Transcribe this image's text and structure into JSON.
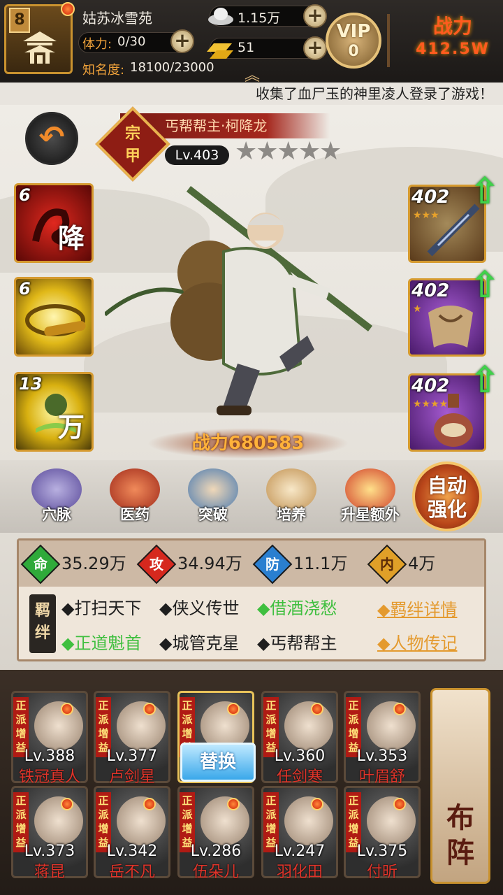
{
  "player": {
    "level": "8",
    "name": "姑苏冰雪苑",
    "stamina_label": "体力:",
    "stamina_value": "0/30",
    "fame_label": "知名度:",
    "fame_value": "18100/23000"
  },
  "currency": {
    "silver": "1.15万",
    "gold": "51"
  },
  "vip": {
    "label": "VIP",
    "level": "0"
  },
  "top_power": {
    "label": "战力",
    "value": "412.5W"
  },
  "marquee": "收集了血尸玉的神里凌人登录了游戏！",
  "hero": {
    "title": "丐帮帮主·柯降龙",
    "sect_badge": "宗\n甲",
    "level": "Lv.403",
    "stars": "★★★★★",
    "stars_count": 5,
    "power_label": "战力",
    "power_value": "680583"
  },
  "skills": [
    {
      "count": "6",
      "glyph": "降",
      "icon": "dragon-skill-icon"
    },
    {
      "count": "6",
      "glyph": "",
      "icon": "whirl-staff-skill-icon"
    },
    {
      "count": "13",
      "glyph": "万",
      "icon": "book-skill-icon"
    }
  ],
  "equipment": [
    {
      "level": "402",
      "stars": "★★★",
      "icon": "staff-weapon-icon"
    },
    {
      "level": "402",
      "stars": "★",
      "icon": "cloak-armor-icon"
    },
    {
      "level": "402",
      "stars": "★★★★",
      "icon": "gourd-accessory-icon"
    }
  ],
  "actions": [
    {
      "label": "穴脉",
      "icon": "meridian-icon"
    },
    {
      "label": "医药",
      "icon": "medicine-icon"
    },
    {
      "label": "突破",
      "icon": "breakthrough-icon"
    },
    {
      "label": "培养",
      "icon": "cultivate-icon"
    },
    {
      "label": "升星额外",
      "icon": "star-up-icon"
    }
  ],
  "auto_enhance": "自动\n强化",
  "stats": [
    {
      "glyph": "命",
      "value": "35.29万",
      "color": "#2faa3a"
    },
    {
      "glyph": "攻",
      "value": "34.94万",
      "color": "#d6281e"
    },
    {
      "glyph": "防",
      "value": "11.1万",
      "color": "#2a7fd0"
    },
    {
      "glyph": "内",
      "value": "4万",
      "color": "#e0a028"
    }
  ],
  "bond_tag": "羁\n绊",
  "bonds": [
    {
      "text": "◆打扫天下",
      "active": false
    },
    {
      "text": "◆侠义传世",
      "active": false
    },
    {
      "text": "◆借酒浇愁",
      "active": true
    },
    {
      "text": "◆正道魁首",
      "active": true
    },
    {
      "text": "◆城管克星",
      "active": false
    },
    {
      "text": "◆丐帮帮主",
      "active": false
    }
  ],
  "links": {
    "bond_detail": "◆羁绊详情",
    "biography": "◆人物传记"
  },
  "team_tag": "正派增益",
  "swap_label": "替换",
  "team": [
    {
      "level": "Lv.388",
      "name": "铁冠真人"
    },
    {
      "level": "Lv.377",
      "name": "卢剑星"
    },
    {
      "level": "",
      "name": ""
    },
    {
      "level": "Lv.360",
      "name": "任剑寒"
    },
    {
      "level": "Lv.353",
      "name": "叶眉舒"
    },
    {
      "level": "Lv.373",
      "name": "蒋昆"
    },
    {
      "level": "Lv.342",
      "name": "岳不凡"
    },
    {
      "level": "Lv.286",
      "name": "伍朵儿"
    },
    {
      "level": "Lv.247",
      "name": "羽化田"
    },
    {
      "level": "Lv.375",
      "name": "付昕"
    }
  ],
  "formation_label": {
    "top": "布",
    "bottom": "阵"
  }
}
